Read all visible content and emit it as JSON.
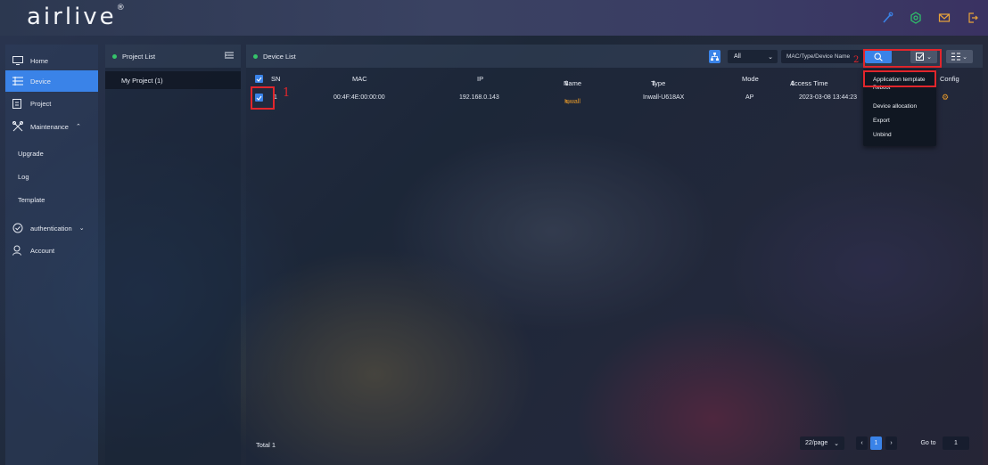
{
  "brand": {
    "logo_text": "airlive",
    "logo_mark": "®"
  },
  "header_icons": [
    "wand-icon",
    "gear-hex-icon",
    "mail-icon",
    "logout-icon"
  ],
  "sidebar": {
    "items": [
      {
        "label": "Home",
        "icon": "monitor-icon"
      },
      {
        "label": "Device",
        "icon": "list-icon",
        "active": true
      },
      {
        "label": "Project",
        "icon": "project-icon"
      },
      {
        "label": "Maintenance",
        "icon": "tools-icon",
        "expanded": true
      },
      {
        "label": "Upgrade"
      },
      {
        "label": "Log"
      },
      {
        "label": "Template"
      },
      {
        "label": "authentication",
        "icon": "shield-icon"
      },
      {
        "label": "Account",
        "icon": "account-icon"
      }
    ]
  },
  "project_panel": {
    "title": "Project List",
    "projects": [
      {
        "label": "My Project (1)"
      }
    ]
  },
  "device_panel": {
    "title": "Device List",
    "filter_value": "All",
    "search_placeholder": "MAC/Type/Device Name",
    "columns": [
      "SN",
      "MAC",
      "IP",
      "Name",
      "Type",
      "Mode",
      "Access Time",
      "Config"
    ],
    "rows": [
      {
        "sn": "1",
        "mac": "00:4F:4E:00:00:00",
        "ip": "192.168.0.143",
        "name": "Inwall",
        "type": "Inwall-U618AX",
        "mode": "AP",
        "access_time": "2023-03-08 13:44:23"
      }
    ],
    "total": "Total 1",
    "per_page": "22/page",
    "current_page": "1",
    "goto_label": "Go to",
    "goto_value": "1"
  },
  "batch_menu": {
    "items": [
      "Application template",
      "Reboot",
      "Device allocation",
      "Export",
      "Unbind"
    ]
  },
  "annotations": {
    "step1": "1",
    "step2": "2",
    "color": "#e2262c"
  },
  "colors": {
    "accent": "#3a83e8",
    "status_green": "#35c46a",
    "link_orange": "#e89a2a"
  }
}
